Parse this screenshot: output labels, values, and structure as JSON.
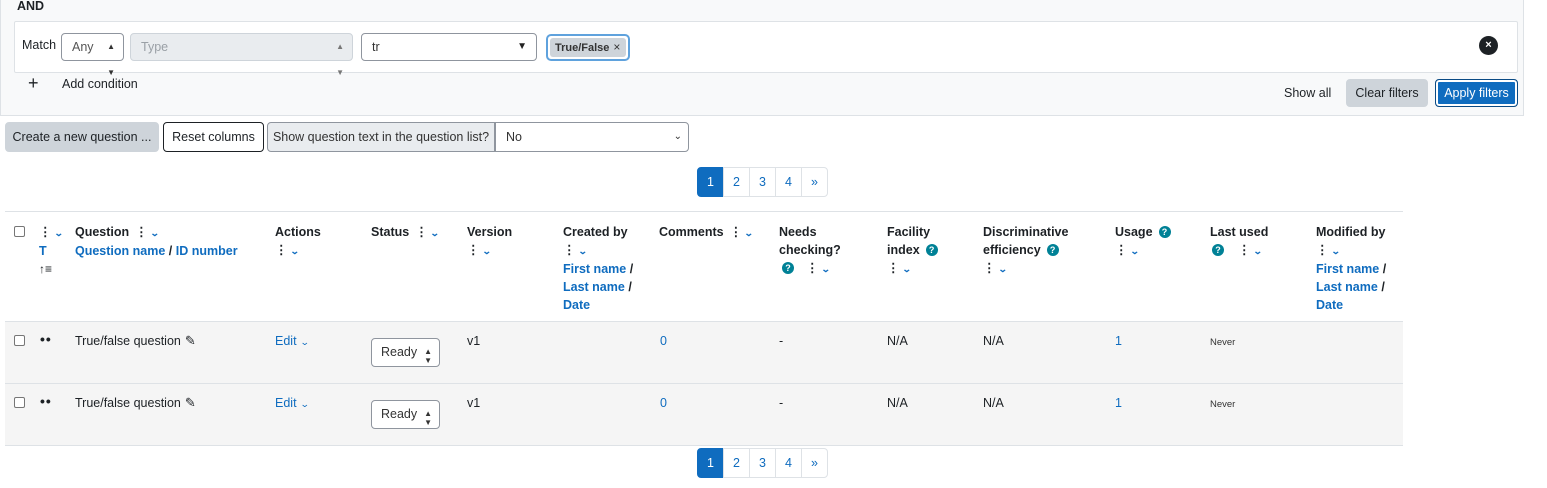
{
  "filter": {
    "join_label": "AND",
    "match_label": "Match",
    "match_value": "Any",
    "type_placeholder": "Type",
    "search_value": "tr",
    "chip_label": "True/False",
    "chip_remove": "×",
    "remove_condition": "×",
    "add_condition_icon": "+",
    "add_condition_label": "Add condition",
    "show_all": "Show all",
    "clear_filters": "Clear filters",
    "apply_filters": "Apply filters"
  },
  "toolbar": {
    "create_question": "Create a new question ...",
    "reset_columns": "Reset columns",
    "show_text_label": "Show question text in the question list?",
    "show_text_value": "No"
  },
  "pagination": {
    "pages": [
      "1",
      "2",
      "3",
      "4"
    ],
    "next": "»",
    "active": "1"
  },
  "table": {
    "headers": {
      "type_sort": "T",
      "question": "Question",
      "question_name": "Question name",
      "slash": "/",
      "id_number": "ID number",
      "actions": "Actions",
      "status": "Status",
      "version": "Version",
      "created_by": "Created by",
      "first_name": "First name",
      "last_name": "Last name",
      "date": "Date",
      "comments": "Comments",
      "needs_checking_1": "Needs",
      "needs_checking_2": "checking?",
      "facility_1": "Facility",
      "facility_2": "index",
      "discriminative_1": "Discriminative",
      "discriminative_2": "efficiency",
      "usage": "Usage",
      "last_used": "Last used",
      "modified_by": "Modified by"
    },
    "rows": [
      {
        "name": "True/false question",
        "action": "Edit",
        "status": "Ready",
        "version": "v1",
        "comments": "0",
        "needs_checking": "-",
        "facility": "N/A",
        "discriminative": "N/A",
        "usage": "1",
        "last_used": "Never"
      },
      {
        "name": "True/false question",
        "action": "Edit",
        "status": "Ready",
        "version": "v1",
        "comments": "0",
        "needs_checking": "-",
        "facility": "N/A",
        "discriminative": "N/A",
        "usage": "1",
        "last_used": "Never"
      }
    ]
  },
  "colors": {
    "primary": "#0f6cbf",
    "help": "#008196",
    "secondary_btn": "#ced4da"
  }
}
